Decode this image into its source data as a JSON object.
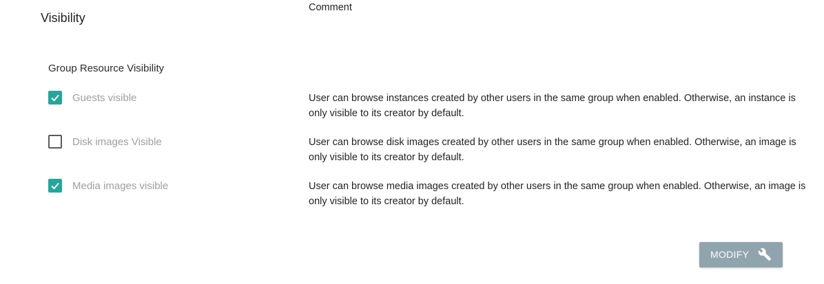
{
  "section": {
    "title": "Visibility"
  },
  "table": {
    "headers": {
      "group": "Group Resource Visibility",
      "comment": "Comment"
    },
    "rows": [
      {
        "label": "Guests visible",
        "checked": true,
        "comment": "User can browse instances created by other users in the same group when enabled. Otherwise, an instance is only visible to its creator by default."
      },
      {
        "label": "Disk images Visible",
        "checked": false,
        "comment": "User can browse disk images created by other users in the same group when enabled. Otherwise, an image is only visible to its creator by default."
      },
      {
        "label": "Media images visible",
        "checked": true,
        "comment": "User can browse media images created by other users in the same group when enabled. Otherwise, an image is only visible to its creator by default."
      }
    ]
  },
  "actions": {
    "modify_label": "MODIFY",
    "modify_icon": "wrench-icon"
  },
  "colors": {
    "checkbox_checked": "#26a69a",
    "checkbox_unchecked_border": "#5a5a5a",
    "label_muted": "#9e9e9e",
    "button_bg": "#90a4ae",
    "button_text": "#ffffff"
  }
}
